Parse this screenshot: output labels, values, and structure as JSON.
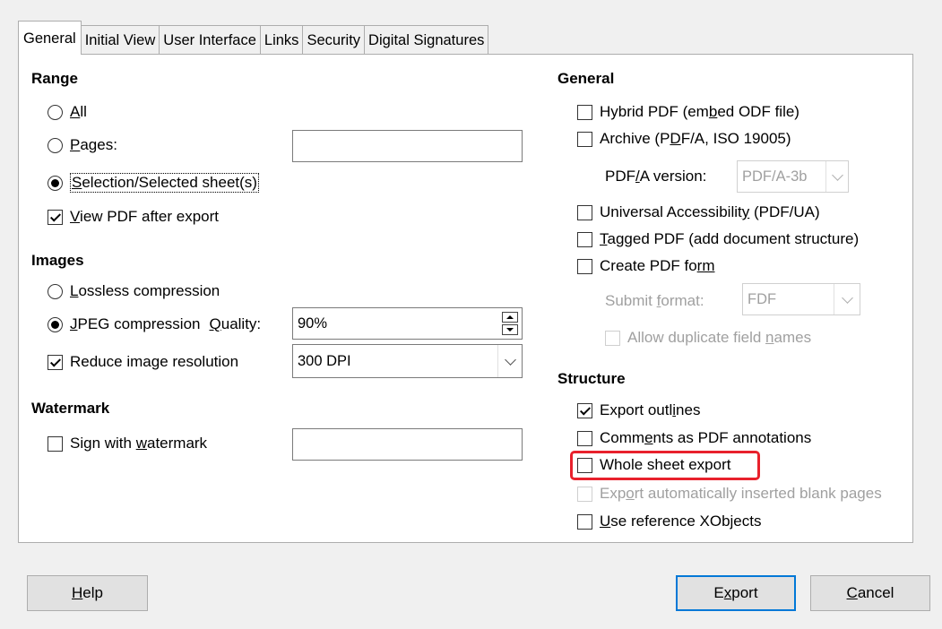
{
  "tabs": [
    "General",
    "Initial View",
    "User Interface",
    "Links",
    "Security",
    "Digital Signatures"
  ],
  "range": {
    "heading": "Range",
    "all_pre": "",
    "all_u": "A",
    "all_post": "ll",
    "pages_pre": "",
    "pages_u": "P",
    "pages_post": "ages:",
    "pages_value": "",
    "selection_pre": "",
    "selection_u": "S",
    "selection_post": "election/Selected sheet(s)",
    "view_pre": "",
    "view_u": "V",
    "view_post": "iew PDF after export"
  },
  "images": {
    "heading": "Images",
    "lossless_pre": "",
    "lossless_u": "L",
    "lossless_post": "ossless compression",
    "jpeg_pre": "",
    "jpeg_u": "J",
    "jpeg_post": "PEG compression",
    "quality_pre": "",
    "quality_u": "Q",
    "quality_post": "uality:",
    "quality_value": "90%",
    "reduce_pre": "Reduce ima",
    "reduce_u": "g",
    "reduce_post": "e resolution",
    "dpi_value": "300 DPI"
  },
  "watermark": {
    "heading": "Watermark",
    "sign_pre": "Sign with ",
    "sign_u": "w",
    "sign_post": "atermark",
    "value": ""
  },
  "general": {
    "heading": "General",
    "hybrid_pre": "Hybrid PDF (em",
    "hybrid_u": "b",
    "hybrid_post": "ed ODF file)",
    "archive_pre": "Archive (P",
    "archive_u": "D",
    "archive_post": "F/A, ISO 19005)",
    "pdfa_pre": "PDF",
    "pdfa_u": "/",
    "pdfa_post": "A version:",
    "pdfa_value": "PDF/A-3b",
    "ua_pre": "Universal Accessibilit",
    "ua_u": "y",
    "ua_post": " (PDF/UA)",
    "tagged_pre": "",
    "tagged_u": "T",
    "tagged_post": "agged PDF (add document structure)",
    "form_pre": "Create PDF fo",
    "form_u": "rm",
    "form_post": "",
    "submit_pre": "Submit ",
    "submit_u": "f",
    "submit_post": "ormat:",
    "submit_value": "FDF",
    "dup_pre": "Allow duplicate field ",
    "dup_u": "n",
    "dup_post": "ames"
  },
  "structure": {
    "heading": "Structure",
    "outlines_pre": "Export outl",
    "outlines_u": "i",
    "outlines_post": "nes",
    "comments_pre": "Comm",
    "comments_u": "e",
    "comments_post": "nts as PDF annotations",
    "whole": "Whole sheet export",
    "blank_pre": "Exp",
    "blank_u": "o",
    "blank_post": "rt automatically inserted blank pages",
    "xobj_pre": "",
    "xobj_u": "U",
    "xobj_post": "se reference XObjects"
  },
  "buttons": {
    "help_pre": "",
    "help_u": "H",
    "help_post": "elp",
    "export_pre": "E",
    "export_u": "x",
    "export_post": "port",
    "cancel_pre": "",
    "cancel_u": "C",
    "cancel_post": "ancel"
  },
  "colors": {
    "highlight": "#e8212c",
    "accent": "#0078d7"
  }
}
